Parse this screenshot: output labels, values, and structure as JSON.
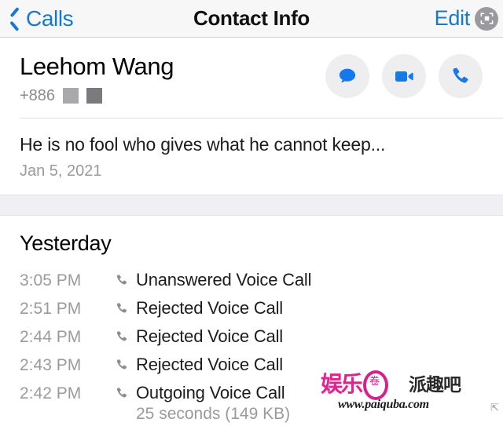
{
  "navbar": {
    "back_label": "Calls",
    "back_icon": "chevron-left-icon",
    "title": "Contact Info",
    "edit_label": "Edit",
    "capture_icon": "screenshot-capture-icon"
  },
  "contact": {
    "name": "Leehom Wang",
    "phone_prefix": "+886",
    "redacted_blocks": [
      "light",
      "dark"
    ],
    "actions": [
      {
        "name": "message-button",
        "icon": "chat-bubble-icon",
        "color": "#1678ea"
      },
      {
        "name": "video-call-button",
        "icon": "video-camera-icon",
        "color": "#1678ea"
      },
      {
        "name": "voice-call-button",
        "icon": "phone-icon",
        "color": "#1678ea"
      }
    ]
  },
  "status": {
    "text": "He is no fool who gives what he cannot keep...",
    "date": "Jan 5, 2021"
  },
  "history": {
    "title": "Yesterday",
    "calls": [
      {
        "time": "3:05 PM",
        "icon": "phone-icon",
        "label": "Unanswered Voice Call",
        "meta": ""
      },
      {
        "time": "2:51 PM",
        "icon": "phone-icon",
        "label": "Rejected Voice Call",
        "meta": ""
      },
      {
        "time": "2:44 PM",
        "icon": "phone-icon",
        "label": "Rejected Voice Call",
        "meta": ""
      },
      {
        "time": "2:43 PM",
        "icon": "phone-icon",
        "label": "Rejected Voice Call",
        "meta": ""
      },
      {
        "time": "2:42 PM",
        "icon": "phone-icon",
        "label": "Outgoing Voice Call",
        "meta": "25 seconds (149 KB)"
      }
    ],
    "last_call_meta": "25 seconds (149 KB)"
  },
  "watermark": {
    "brand_cn": "娱乐",
    "ring_text": "卷",
    "site_cn": "派趣吧",
    "url": "www.paiquba.com"
  },
  "colors": {
    "accent_blue": "#1678d4",
    "icon_blue": "#1678ea",
    "nav_bg": "#f7f7f7",
    "section_gap": "#f0f0f4",
    "muted_text": "#9a9a9f",
    "watermark_pink": "#e4218c"
  }
}
